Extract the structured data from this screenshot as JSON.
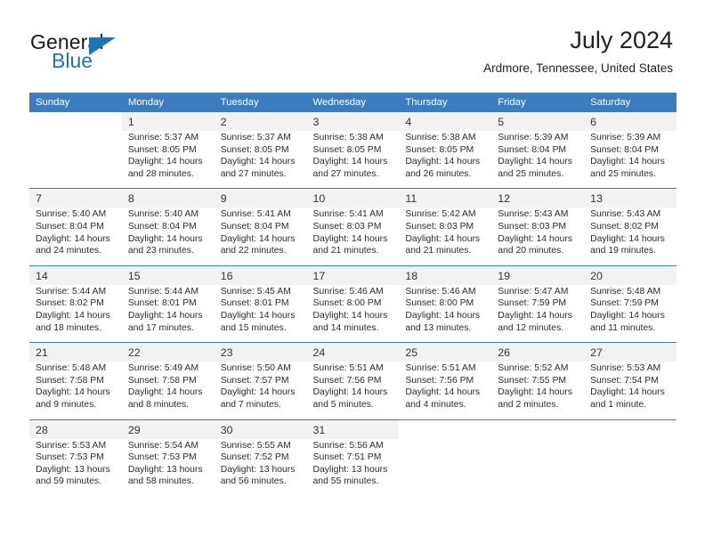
{
  "brand": {
    "name_top": "General",
    "name_bottom": "Blue",
    "accent_color": "#1f71b8",
    "triangle_icon": "triangle-icon"
  },
  "header": {
    "title": "July 2024",
    "subtitle": "Ardmore, Tennessee, United States"
  },
  "calendar": {
    "header_bg": "#3b7dbf",
    "daynum_bg": "#f2f2f2",
    "weekdays": [
      "Sunday",
      "Monday",
      "Tuesday",
      "Wednesday",
      "Thursday",
      "Friday",
      "Saturday"
    ],
    "weeks": [
      [
        {
          "day": "",
          "sunrise": "",
          "sunset": "",
          "daylight": "",
          "daylight2": ""
        },
        {
          "day": "1",
          "sunrise": "Sunrise: 5:37 AM",
          "sunset": "Sunset: 8:05 PM",
          "daylight": "Daylight: 14 hours",
          "daylight2": "and 28 minutes."
        },
        {
          "day": "2",
          "sunrise": "Sunrise: 5:37 AM",
          "sunset": "Sunset: 8:05 PM",
          "daylight": "Daylight: 14 hours",
          "daylight2": "and 27 minutes."
        },
        {
          "day": "3",
          "sunrise": "Sunrise: 5:38 AM",
          "sunset": "Sunset: 8:05 PM",
          "daylight": "Daylight: 14 hours",
          "daylight2": "and 27 minutes."
        },
        {
          "day": "4",
          "sunrise": "Sunrise: 5:38 AM",
          "sunset": "Sunset: 8:05 PM",
          "daylight": "Daylight: 14 hours",
          "daylight2": "and 26 minutes."
        },
        {
          "day": "5",
          "sunrise": "Sunrise: 5:39 AM",
          "sunset": "Sunset: 8:04 PM",
          "daylight": "Daylight: 14 hours",
          "daylight2": "and 25 minutes."
        },
        {
          "day": "6",
          "sunrise": "Sunrise: 5:39 AM",
          "sunset": "Sunset: 8:04 PM",
          "daylight": "Daylight: 14 hours",
          "daylight2": "and 25 minutes."
        }
      ],
      [
        {
          "day": "7",
          "sunrise": "Sunrise: 5:40 AM",
          "sunset": "Sunset: 8:04 PM",
          "daylight": "Daylight: 14 hours",
          "daylight2": "and 24 minutes."
        },
        {
          "day": "8",
          "sunrise": "Sunrise: 5:40 AM",
          "sunset": "Sunset: 8:04 PM",
          "daylight": "Daylight: 14 hours",
          "daylight2": "and 23 minutes."
        },
        {
          "day": "9",
          "sunrise": "Sunrise: 5:41 AM",
          "sunset": "Sunset: 8:04 PM",
          "daylight": "Daylight: 14 hours",
          "daylight2": "and 22 minutes."
        },
        {
          "day": "10",
          "sunrise": "Sunrise: 5:41 AM",
          "sunset": "Sunset: 8:03 PM",
          "daylight": "Daylight: 14 hours",
          "daylight2": "and 21 minutes."
        },
        {
          "day": "11",
          "sunrise": "Sunrise: 5:42 AM",
          "sunset": "Sunset: 8:03 PM",
          "daylight": "Daylight: 14 hours",
          "daylight2": "and 21 minutes."
        },
        {
          "day": "12",
          "sunrise": "Sunrise: 5:43 AM",
          "sunset": "Sunset: 8:03 PM",
          "daylight": "Daylight: 14 hours",
          "daylight2": "and 20 minutes."
        },
        {
          "day": "13",
          "sunrise": "Sunrise: 5:43 AM",
          "sunset": "Sunset: 8:02 PM",
          "daylight": "Daylight: 14 hours",
          "daylight2": "and 19 minutes."
        }
      ],
      [
        {
          "day": "14",
          "sunrise": "Sunrise: 5:44 AM",
          "sunset": "Sunset: 8:02 PM",
          "daylight": "Daylight: 14 hours",
          "daylight2": "and 18 minutes."
        },
        {
          "day": "15",
          "sunrise": "Sunrise: 5:44 AM",
          "sunset": "Sunset: 8:01 PM",
          "daylight": "Daylight: 14 hours",
          "daylight2": "and 17 minutes."
        },
        {
          "day": "16",
          "sunrise": "Sunrise: 5:45 AM",
          "sunset": "Sunset: 8:01 PM",
          "daylight": "Daylight: 14 hours",
          "daylight2": "and 15 minutes."
        },
        {
          "day": "17",
          "sunrise": "Sunrise: 5:46 AM",
          "sunset": "Sunset: 8:00 PM",
          "daylight": "Daylight: 14 hours",
          "daylight2": "and 14 minutes."
        },
        {
          "day": "18",
          "sunrise": "Sunrise: 5:46 AM",
          "sunset": "Sunset: 8:00 PM",
          "daylight": "Daylight: 14 hours",
          "daylight2": "and 13 minutes."
        },
        {
          "day": "19",
          "sunrise": "Sunrise: 5:47 AM",
          "sunset": "Sunset: 7:59 PM",
          "daylight": "Daylight: 14 hours",
          "daylight2": "and 12 minutes."
        },
        {
          "day": "20",
          "sunrise": "Sunrise: 5:48 AM",
          "sunset": "Sunset: 7:59 PM",
          "daylight": "Daylight: 14 hours",
          "daylight2": "and 11 minutes."
        }
      ],
      [
        {
          "day": "21",
          "sunrise": "Sunrise: 5:48 AM",
          "sunset": "Sunset: 7:58 PM",
          "daylight": "Daylight: 14 hours",
          "daylight2": "and 9 minutes."
        },
        {
          "day": "22",
          "sunrise": "Sunrise: 5:49 AM",
          "sunset": "Sunset: 7:58 PM",
          "daylight": "Daylight: 14 hours",
          "daylight2": "and 8 minutes."
        },
        {
          "day": "23",
          "sunrise": "Sunrise: 5:50 AM",
          "sunset": "Sunset: 7:57 PM",
          "daylight": "Daylight: 14 hours",
          "daylight2": "and 7 minutes."
        },
        {
          "day": "24",
          "sunrise": "Sunrise: 5:51 AM",
          "sunset": "Sunset: 7:56 PM",
          "daylight": "Daylight: 14 hours",
          "daylight2": "and 5 minutes."
        },
        {
          "day": "25",
          "sunrise": "Sunrise: 5:51 AM",
          "sunset": "Sunset: 7:56 PM",
          "daylight": "Daylight: 14 hours",
          "daylight2": "and 4 minutes."
        },
        {
          "day": "26",
          "sunrise": "Sunrise: 5:52 AM",
          "sunset": "Sunset: 7:55 PM",
          "daylight": "Daylight: 14 hours",
          "daylight2": "and 2 minutes."
        },
        {
          "day": "27",
          "sunrise": "Sunrise: 5:53 AM",
          "sunset": "Sunset: 7:54 PM",
          "daylight": "Daylight: 14 hours",
          "daylight2": "and 1 minute."
        }
      ],
      [
        {
          "day": "28",
          "sunrise": "Sunrise: 5:53 AM",
          "sunset": "Sunset: 7:53 PM",
          "daylight": "Daylight: 13 hours",
          "daylight2": "and 59 minutes."
        },
        {
          "day": "29",
          "sunrise": "Sunrise: 5:54 AM",
          "sunset": "Sunset: 7:53 PM",
          "daylight": "Daylight: 13 hours",
          "daylight2": "and 58 minutes."
        },
        {
          "day": "30",
          "sunrise": "Sunrise: 5:55 AM",
          "sunset": "Sunset: 7:52 PM",
          "daylight": "Daylight: 13 hours",
          "daylight2": "and 56 minutes."
        },
        {
          "day": "31",
          "sunrise": "Sunrise: 5:56 AM",
          "sunset": "Sunset: 7:51 PM",
          "daylight": "Daylight: 13 hours",
          "daylight2": "and 55 minutes."
        },
        {
          "day": "",
          "sunrise": "",
          "sunset": "",
          "daylight": "",
          "daylight2": ""
        },
        {
          "day": "",
          "sunrise": "",
          "sunset": "",
          "daylight": "",
          "daylight2": ""
        },
        {
          "day": "",
          "sunrise": "",
          "sunset": "",
          "daylight": "",
          "daylight2": ""
        }
      ]
    ]
  }
}
